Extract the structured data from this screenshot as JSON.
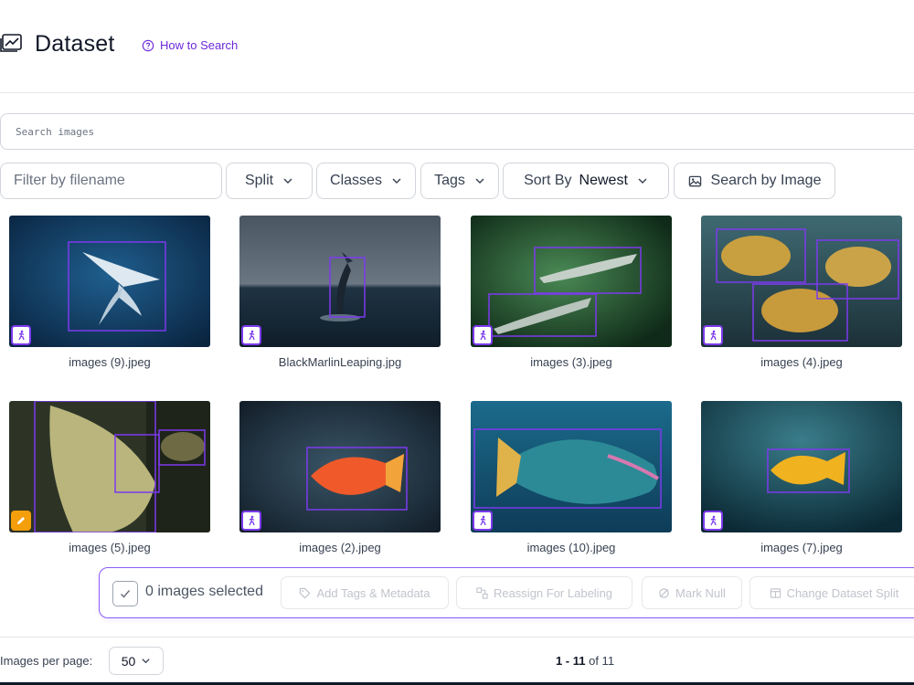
{
  "header": {
    "title": "Dataset",
    "how_to_search": "How to Search",
    "accent": "#6d28d9"
  },
  "search": {
    "placeholder": "Search images"
  },
  "filters": {
    "filename_placeholder": "Filter by filename",
    "split_label": "Split",
    "classes_label": "Classes",
    "tags_label": "Tags",
    "sort_label": "Sort By",
    "sort_value": "Newest",
    "search_by_image": "Search by Image"
  },
  "images": [
    {
      "filename": "images (9).jpeg",
      "status_icon": "person-run-icon"
    },
    {
      "filename": "BlackMarlinLeaping.jpg",
      "status_icon": "person-run-icon"
    },
    {
      "filename": "images (3).jpeg",
      "status_icon": "person-run-icon"
    },
    {
      "filename": "images (4).jpeg",
      "status_icon": "person-run-icon"
    },
    {
      "filename": "images (5).jpeg",
      "status_icon": "pencil-icon"
    },
    {
      "filename": "images (2).jpeg",
      "status_icon": "person-run-icon"
    },
    {
      "filename": "images (10).jpeg",
      "status_icon": "person-run-icon"
    },
    {
      "filename": "images (7).jpeg",
      "status_icon": "person-run-icon"
    }
  ],
  "selection": {
    "count_text": "0 images selected",
    "add_tags": "Add Tags & Metadata",
    "reassign": "Reassign For Labeling",
    "mark_null": "Mark Null",
    "change_split": "Change Dataset Split"
  },
  "footer": {
    "per_page_label": "Images per page:",
    "per_page_value": "50",
    "range": "1 - 11",
    "of_text": "of 11"
  },
  "colors": {
    "box": "#7c3aed",
    "edit_badge": "#f59e0b"
  }
}
